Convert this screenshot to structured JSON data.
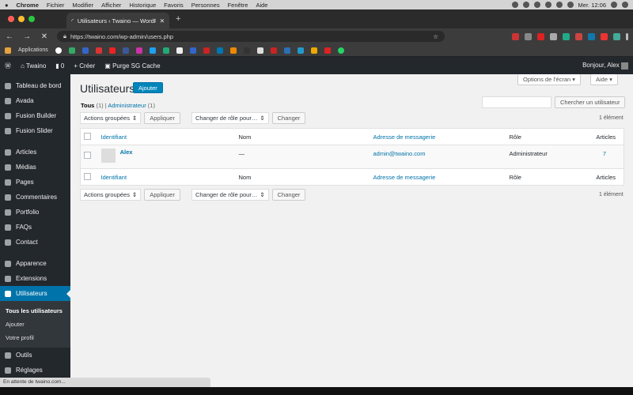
{
  "mac_menu": {
    "app": "Chrome",
    "items": [
      "Fichier",
      "Modifier",
      "Afficher",
      "Historique",
      "Favoris",
      "Personnes",
      "Fenêtre",
      "Aide"
    ],
    "clock": "Mer. 12:06"
  },
  "browser": {
    "tab_title": "Utilisateurs ‹ Twaino — WordP",
    "new_tab": "+",
    "url": "https://twaino.com/wp-admin/users.php",
    "bookmarks_label": "Applications"
  },
  "admin_bar": {
    "site": "Twaino",
    "comments": "0",
    "new": "Créer",
    "purge": "Purge SG Cache",
    "greeting": "Bonjour, Alex"
  },
  "sidebar": {
    "items": [
      {
        "label": "Tableau de bord",
        "icon": "dashboard-icon"
      },
      {
        "label": "Avada",
        "icon": "avada-icon"
      },
      {
        "label": "Fusion Builder",
        "icon": "fusion-builder-icon"
      },
      {
        "label": "Fusion Slider",
        "icon": "fusion-slider-icon"
      },
      {
        "label": "Articles",
        "icon": "pin-icon"
      },
      {
        "label": "Médias",
        "icon": "media-icon"
      },
      {
        "label": "Pages",
        "icon": "pages-icon"
      },
      {
        "label": "Commentaires",
        "icon": "comments-icon"
      },
      {
        "label": "Portfolio",
        "icon": "portfolio-icon"
      },
      {
        "label": "FAQs",
        "icon": "faq-icon"
      },
      {
        "label": "Contact",
        "icon": "contact-icon"
      },
      {
        "label": "Apparence",
        "icon": "appearance-icon"
      },
      {
        "label": "Extensions",
        "icon": "plugins-icon"
      },
      {
        "label": "Utilisateurs",
        "icon": "users-icon"
      },
      {
        "label": "Outils",
        "icon": "tools-icon"
      },
      {
        "label": "Réglages",
        "icon": "settings-icon"
      }
    ],
    "submenu": [
      "Tous les utilisateurs",
      "Ajouter",
      "Votre profil"
    ]
  },
  "screen_options": "Options de l'écran",
  "help": "Aide",
  "page": {
    "title": "Utilisateurs",
    "add_button": "Ajouter",
    "filter_all": "Tous",
    "filter_all_count": "(1)",
    "filter_sep": "|",
    "filter_admin": "Administrateur",
    "filter_admin_count": "(1)",
    "search_button": "Chercher un utilisateur",
    "search_placeholder": ""
  },
  "bulk": {
    "actions": "Actions groupées",
    "apply": "Appliquer",
    "role_change": "Changer de rôle pour…",
    "change": "Changer",
    "count": "1 élément"
  },
  "table": {
    "headers": [
      "Identifiant",
      "Nom",
      "Adresse de messagerie",
      "Rôle",
      "Articles"
    ],
    "rows": [
      {
        "username": "Alex",
        "name": "—",
        "email": "admin@twaino.com",
        "role": "Administrateur",
        "posts": "7"
      }
    ]
  },
  "status_bar": "En attente de twaino.com..."
}
